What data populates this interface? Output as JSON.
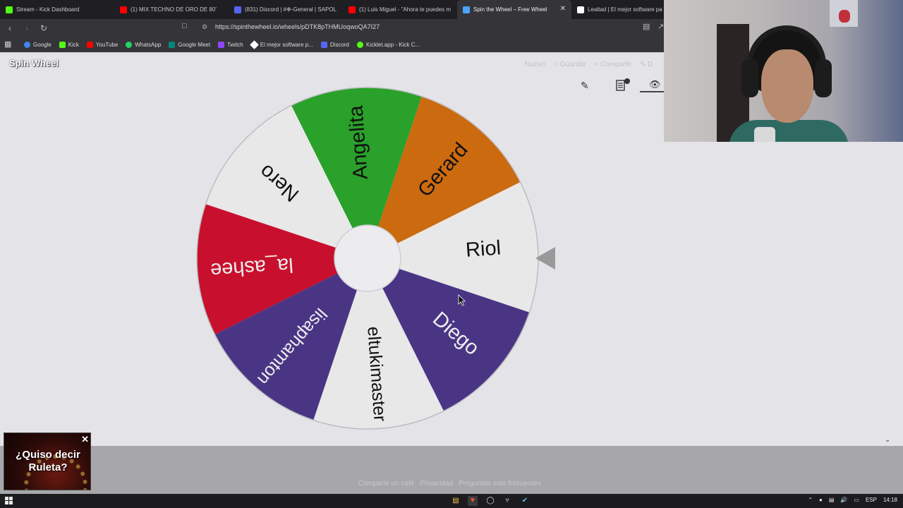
{
  "browser": {
    "tabs": [
      {
        "title": "Stream - Kick Dashboard",
        "favicon_color": "#53fc18",
        "active": false
      },
      {
        "title": "(1) MIX TECHNO DE ORO DE 80'",
        "favicon_color": "#ff0000",
        "active": false
      },
      {
        "title": "(831) Discord | #❉-General | SAPOL",
        "favicon_color": "#5865f2",
        "active": false
      },
      {
        "title": "(1) Luis Miguel - \"Ahora te puedes m",
        "favicon_color": "#ff0000",
        "active": false
      },
      {
        "title": "Spin the Wheel – Free Wheel",
        "favicon_color": "#4aa3ff",
        "active": true
      },
      {
        "title": "Lealtad | El mejor software pa",
        "favicon_color": "#ffffff",
        "active": false
      }
    ],
    "tab_close_glyph": "✕",
    "url": "https://spinthewheel.io/wheels/pDTK8pTHMUoqwoQA7I27",
    "bookmarks": [
      {
        "label": "Google",
        "color": "#4285f4"
      },
      {
        "label": "Kick",
        "color": "#53fc18"
      },
      {
        "label": "YouTube",
        "color": "#ff0000"
      },
      {
        "label": "WhatsApp",
        "color": "#25d366"
      },
      {
        "label": "Google Meet",
        "color": "#00897b"
      },
      {
        "label": "Twitch",
        "color": "#9146ff"
      },
      {
        "label": "El mejor software p...",
        "color": "#ffffff"
      },
      {
        "label": "Discord",
        "color": "#5865f2"
      },
      {
        "label": "Kicklet.app - Kick C...",
        "color": "#53fc18"
      }
    ]
  },
  "page": {
    "logo": "Spin Wheel",
    "toolbar": {
      "new_label": "Nuevo",
      "save_label": "○ Guardar",
      "share_label": "< Compartir",
      "edit_partial": "✎ D"
    },
    "footer": {
      "support": "Comparte un café",
      "privacy": "Privacidad",
      "faq": "Preguntas más frecuentes"
    },
    "ad": {
      "line1": "¿Quiso decir",
      "line2": "Ruleta?",
      "close": "✕"
    }
  },
  "wheel": {
    "segments": [
      {
        "label": "Riol",
        "color": "#e8e8e8",
        "text_color": "#111111"
      },
      {
        "label": "Diego",
        "color": "#4a3585",
        "text_color": "#eeeeee"
      },
      {
        "label": "eltukimaster",
        "color": "#e8e8e8",
        "text_color": "#111111"
      },
      {
        "label": "lisaphamton",
        "color": "#4a3585",
        "text_color": "#eeeeee"
      },
      {
        "label": "la_ashee",
        "color": "#c8102e",
        "text_color": "#eeeeee"
      },
      {
        "label": "Nero",
        "color": "#e8e8e8",
        "text_color": "#111111"
      },
      {
        "label": "Angelita",
        "color": "#2aa12a",
        "text_color": "#111111"
      },
      {
        "label": "Gerard",
        "color": "#cc6a10",
        "text_color": "#111111"
      }
    ],
    "pointer_color": "#999999"
  },
  "taskbar": {
    "language": "ESP",
    "time": "14:18"
  }
}
